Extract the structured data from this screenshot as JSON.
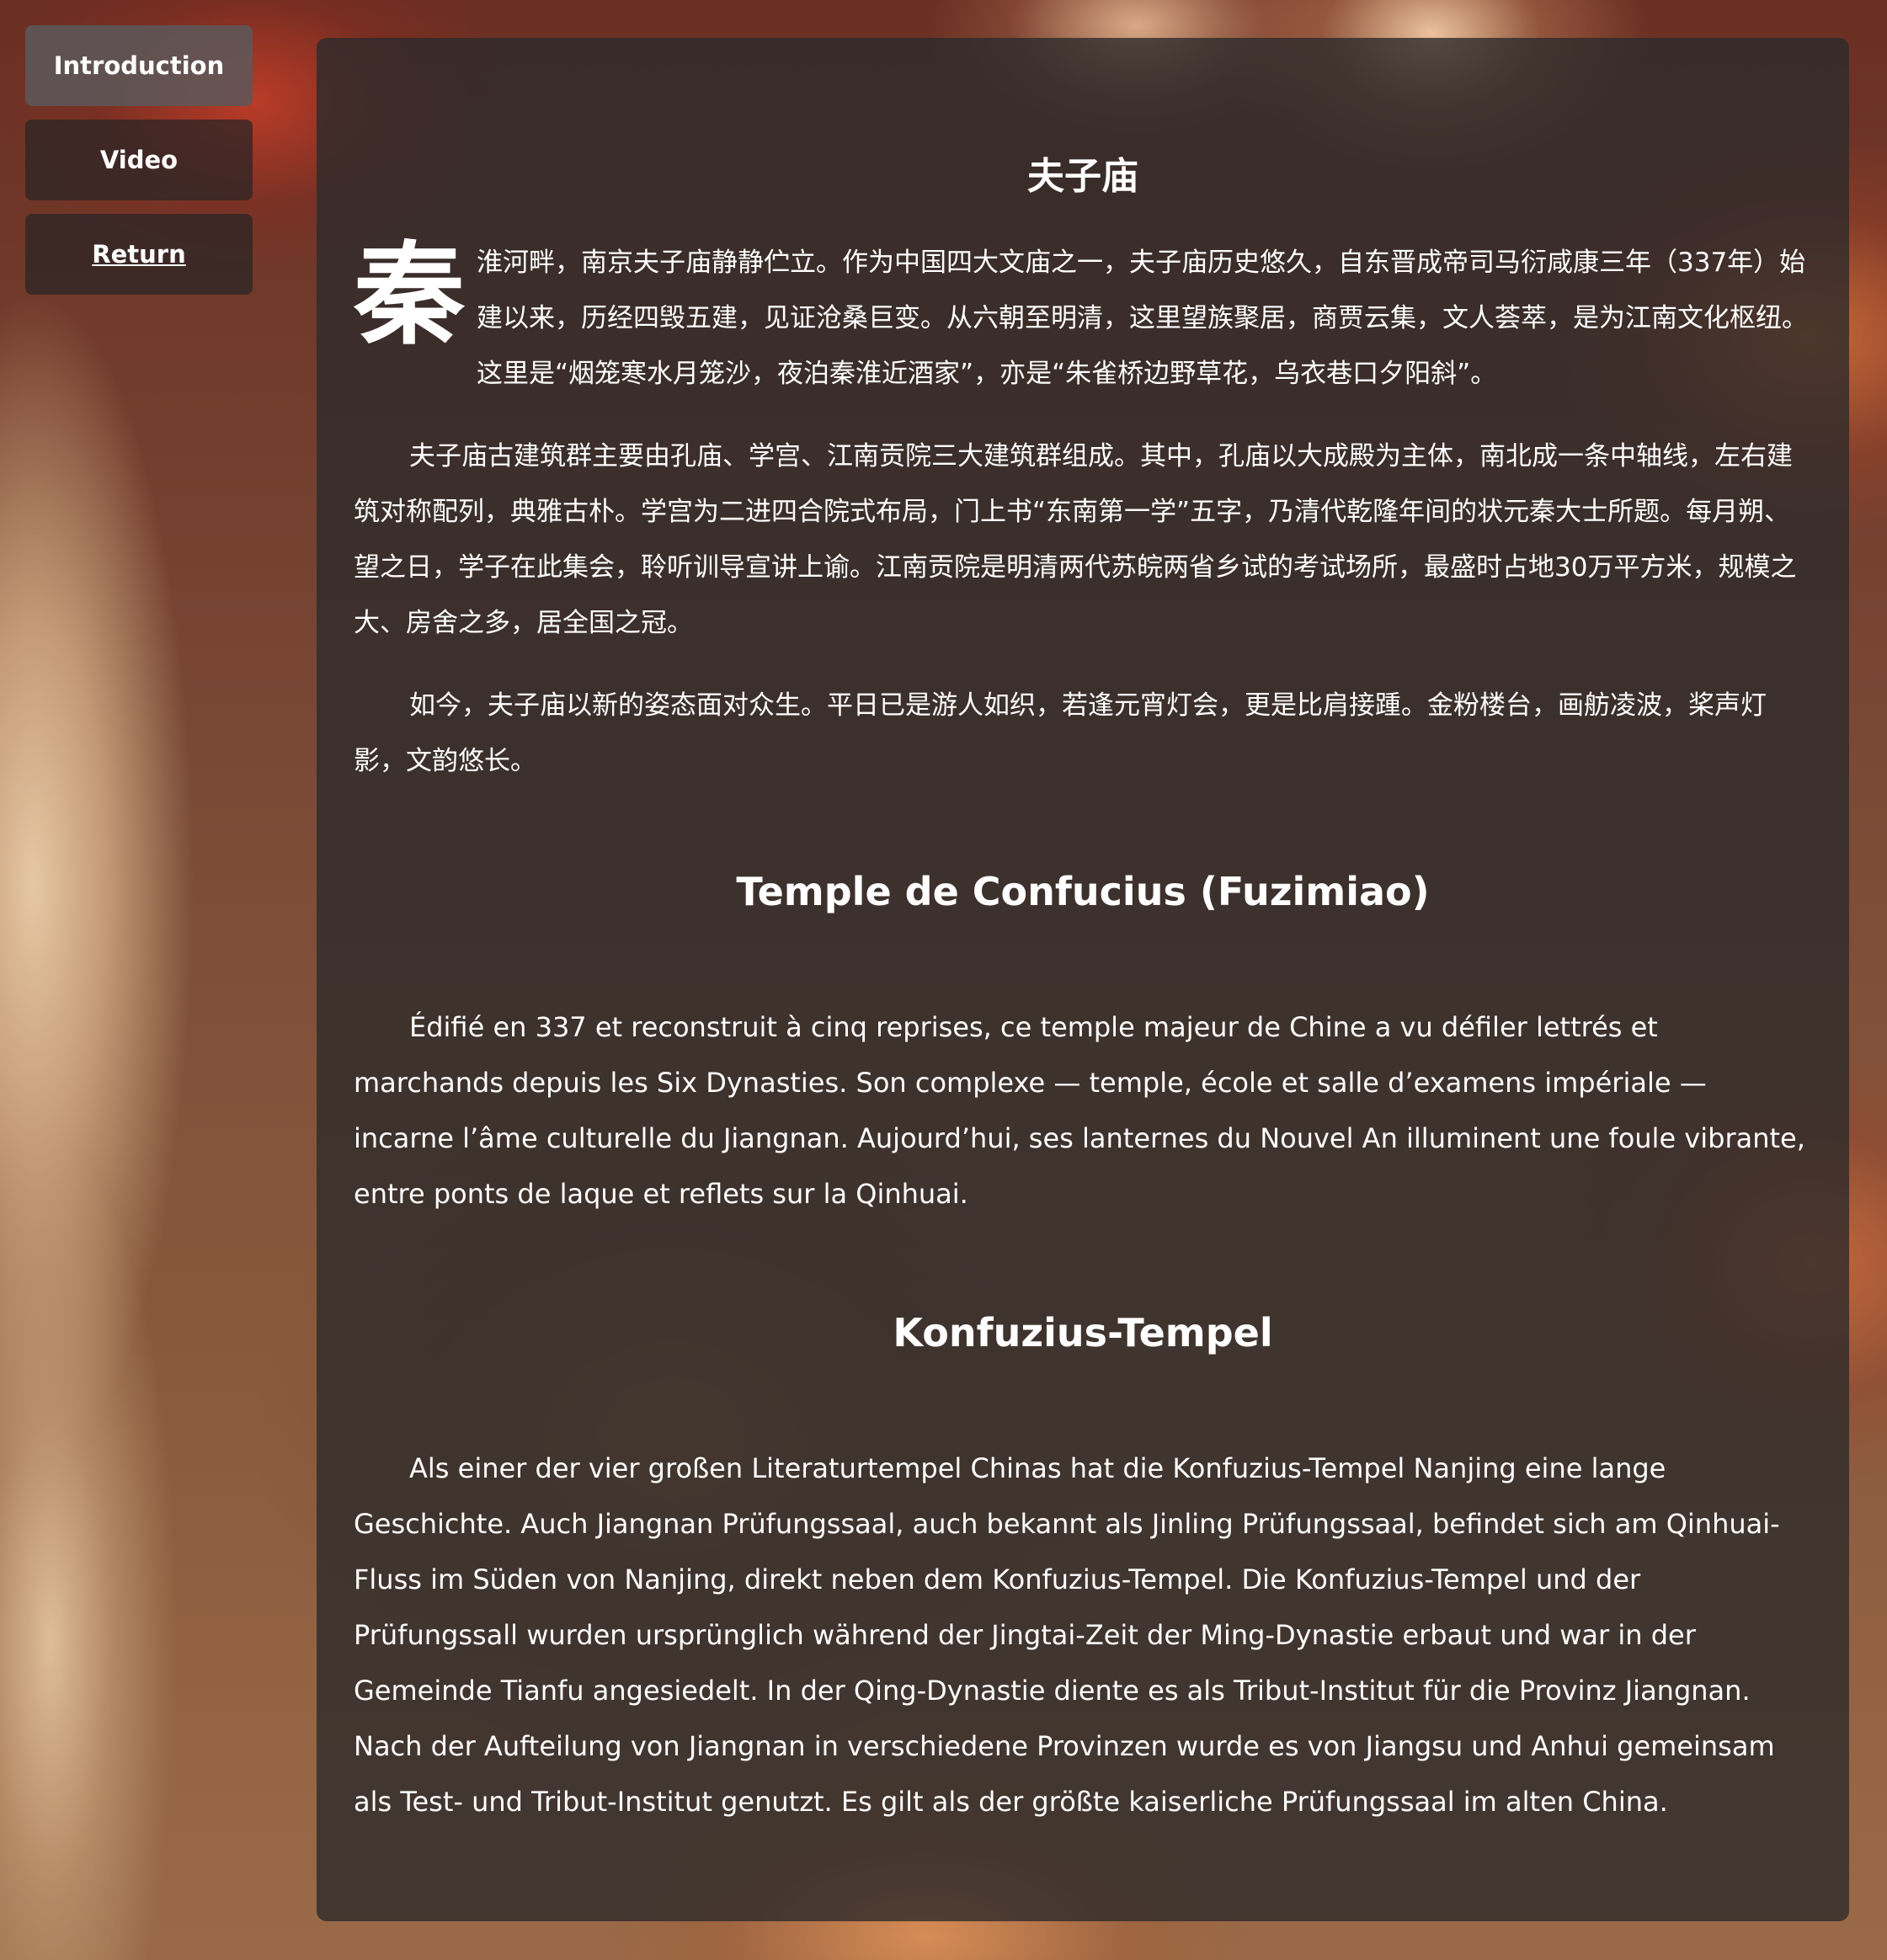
{
  "nav": {
    "introduction": "Introduction",
    "video": "Video",
    "return": "Return"
  },
  "content": {
    "cn_title": "夫子庙",
    "cn_dropcap": "秦",
    "cn_p1": "淮河畔，南京夫子庙静静伫立。作为中国四大文庙之一，夫子庙历史悠久，自东晋成帝司马衍咸康三年（337年）始建以来，历经四毁五建，见证沧桑巨变。从六朝至明清，这里望族聚居，商贾云集，文人荟萃，是为江南文化枢纽。这里是“烟笼寒水月笼沙，夜泊秦淮近酒家”，亦是“朱雀桥边野草花，乌衣巷口夕阳斜”。",
    "cn_p2": "夫子庙古建筑群主要由孔庙、学宫、江南贡院三大建筑群组成。其中，孔庙以大成殿为主体，南北成一条中轴线，左右建筑对称配列，典雅古朴。学宫为二进四合院式布局，门上书“东南第一学”五字，乃清代乾隆年间的状元秦大士所题。每月朔、望之日，学子在此集会，聆听训导宣讲上谕。江南贡院是明清两代苏皖两省乡试的考试场所，最盛时占地30万平方米，规模之大、房舍之多，居全国之冠。",
    "cn_p3": "如今，夫子庙以新的姿态面对众生。平日已是游人如织，若逢元宵灯会，更是比肩接踵。金粉楼台，画舫凌波，桨声灯影，文韵悠长。",
    "fr_title": "Temple de Confucius (Fuzimiao)",
    "fr_p1": "Édifié en 337 et reconstruit à cinq reprises, ce temple majeur de Chine a vu défiler lettrés et marchands depuis les Six Dynasties. Son complexe — temple, école et salle d’examens impériale — incarne l’âme culturelle du Jiangnan. Aujourd’hui, ses lanternes du Nouvel An illuminent une foule vibrante, entre ponts de laque et reflets sur la Qinhuai.",
    "de_title": "Konfuzius-Tempel",
    "de_p1": "Als einer der vier großen Literaturtempel Chinas hat die Konfuzius-Tempel Nanjing eine lange Geschichte. Auch Jiangnan Prüfungssaal, auch bekannt als Jinling Prüfungssaal, befindet sich am Qinhuai-Fluss im Süden von Nanjing, direkt neben dem Konfuzius-Tempel. Die Konfuzius-Tempel und der Prüfungssall wurden ursprünglich während der Jingtai-Zeit der Ming-Dynastie erbaut und war in der Gemeinde Tianfu angesiedelt. In der Qing-Dynastie diente es als Tribut-Institut für die Provinz Jiangnan. Nach der Aufteilung von Jiangnan in verschiedene Provinzen wurde es von Jiangsu und Anhui gemeinsam als Test- und Tribut-Institut genutzt. Es gilt als der größte kaiserliche Prüfungssaal im alten China."
  },
  "colors": {
    "panel_bg": "#2d2a2a",
    "active_button_bg": "#5c585a",
    "button_bg": "#282426",
    "text": "#ffffff"
  }
}
